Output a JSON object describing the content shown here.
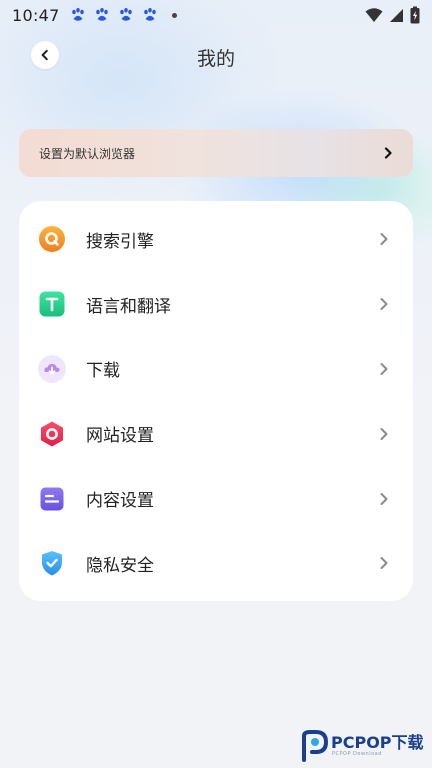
{
  "status_bar": {
    "time": "10:47"
  },
  "header": {
    "title": "我的"
  },
  "default_banner": {
    "label": "设置为默认浏览器"
  },
  "menu": {
    "items": [
      {
        "label": "搜索引擎",
        "icon": "search-engine-icon",
        "color": "#f59a2a"
      },
      {
        "label": "语言和翻译",
        "icon": "translate-icon",
        "color": "#2fd28e"
      },
      {
        "label": "下载",
        "icon": "download-icon",
        "color": "#b98be8"
      },
      {
        "label": "网站设置",
        "icon": "website-settings-icon",
        "color": "#ef2f55"
      },
      {
        "label": "内容设置",
        "icon": "content-settings-icon",
        "color": "#7b63e6"
      },
      {
        "label": "隐私安全",
        "icon": "privacy-shield-icon",
        "color": "#3aa6f2"
      }
    ]
  },
  "watermark": {
    "brand": "PCPOP下载",
    "sub": "PCPOP Download"
  }
}
